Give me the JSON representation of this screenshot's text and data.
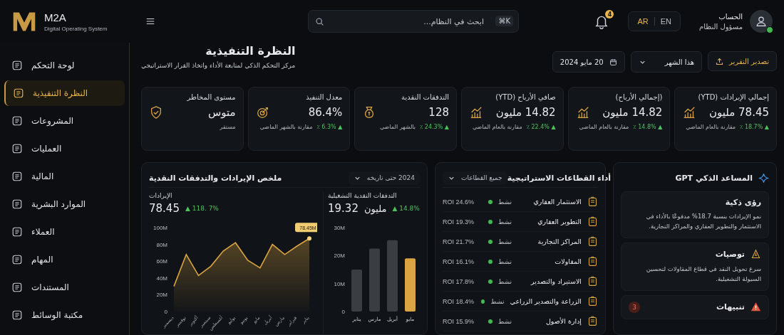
{
  "topbar": {
    "logo_text": "M2A",
    "logo_subtitle": "Digital Operating System",
    "search": {
      "placeholder": "ابحث في النظام...",
      "shortcut": "⌘K"
    },
    "notifications_count": "4",
    "languages": [
      {
        "label": "EN",
        "selected": false
      },
      {
        "label": "AR",
        "selected": true
      }
    ],
    "user": {
      "name": "الحساب",
      "role": "مسؤول النظام",
      "online": true
    }
  },
  "sidebar": {
    "items": [
      {
        "label": "لوحة التحكم",
        "selected": false
      },
      {
        "label": "النظرة التنفيذية",
        "selected": true
      },
      {
        "label": "المشروعات",
        "selected": false
      },
      {
        "label": "العمليات",
        "selected": false
      },
      {
        "label": "المالية",
        "selected": false
      },
      {
        "label": "الموارد البشرية",
        "selected": false
      },
      {
        "label": "العملاء",
        "selected": false
      },
      {
        "label": "المهام",
        "selected": false
      },
      {
        "label": "المستندات",
        "selected": false
      },
      {
        "label": "مكتبة الوسائط",
        "selected": false
      }
    ]
  },
  "header": {
    "title": "النظرة التنفيذية",
    "subtitle": "مركز التحكم الذكي لمتابعة الأداء واتخاذ القرار الاستراتيجي",
    "date": "20 مايو 2024",
    "period": "هذا الشهر",
    "export_button": "تصدير التقرير"
  },
  "kpis": [
    {
      "title": "إجمالي الإيرادات (YTD)",
      "value": "78.45 مليون",
      "change": "▲ 18.7% ٪",
      "note": "مقارنة بالعام الماضي"
    },
    {
      "title": "(إجمالي الأرباح)",
      "value": "14.82 مليون",
      "change": "▲ 14.8% ٪",
      "note": "مقارنة بالعام الماضي"
    },
    {
      "title": "صافي الأرباح (YTD)",
      "value": "14.82 مليون",
      "change": "▲ 22.4% ٪",
      "note": "مقارنة بالعام الماضي"
    },
    {
      "title": "التدفقات النقدية",
      "value": "128",
      "change": "▲ 24.3% ٪",
      "note": "بالشهر الماضي"
    },
    {
      "title": "معدل التنفيذ",
      "value": "86.4%",
      "change": "▲ 6.3% ٪",
      "note": "مقارنة بالشهر الماضي"
    },
    {
      "title": "مستوى المخاطر",
      "value": "متوس",
      "note": "مستقر"
    }
  ],
  "revenue_panel": {
    "title": "ملخص الإيرادات والتدفقات النقدية",
    "filter": "2024 حتى تاريخه",
    "revenue": {
      "label": "الإيرادات",
      "value": "78.45",
      "change": "▲ 118. 7%",
      "chart_data": {
        "type": "area",
        "categories": [
          "ديسمبر",
          "نوفمبر",
          "أكتوبر",
          "سبتمبر",
          "أغسطس",
          "يوليو",
          "يونيو",
          "مايو",
          "أبريل",
          "مارس",
          "فبراير",
          "يناير"
        ],
        "series": [
          {
            "color": "#d9a441",
            "values": [
              30,
              68,
              43,
              54,
              72,
              82,
              61,
              52,
              80,
              68,
              78,
              87
            ]
          }
        ],
        "ylim": [
          0,
          100
        ],
        "yticks": [
          {
            "value": 0,
            "label": "0"
          },
          {
            "value": 20,
            "label": "20M"
          },
          {
            "value": 40,
            "label": "40M"
          },
          {
            "value": 60,
            "label": "60M"
          },
          {
            "value": 80,
            "label": "80M"
          },
          {
            "value": 100,
            "label": "100M"
          }
        ],
        "annotations": [
          {
            "text": "78.45M",
            "x": "يناير",
            "y": 87
          }
        ]
      }
    },
    "cash_flow": {
      "label": "التدفقات النقدية التشغيلية",
      "value": "19.32",
      "unit": "مليون",
      "change": "▲ 14.8%",
      "chart_data": {
        "type": "bar",
        "categories": [
          "يناير",
          "مارس",
          "أبريل",
          "مايو"
        ],
        "series": [
          {
            "color": "#3a3d42",
            "values": [
              15,
              22.5,
              25.5,
              null
            ]
          },
          {
            "color": "#d9a441",
            "values": [
              null,
              null,
              null,
              19
            ]
          }
        ],
        "ylim": [
          0,
          30
        ],
        "yticks": [
          {
            "value": 0,
            "label": "0"
          },
          {
            "value": 10,
            "label": "10M"
          },
          {
            "value": 20,
            "label": "20M"
          },
          {
            "value": 30,
            "label": "30M"
          }
        ]
      }
    }
  },
  "segments_panel": {
    "title": "أداء القطاعات الاستراتيجية",
    "filter": "جميع القطاعات",
    "rows": [
      {
        "name": "الاستثمار العقاري",
        "status": "نشط",
        "color": "#3fb950",
        "roi": "ROI 24.6%"
      },
      {
        "name": "التطوير العقاري",
        "status": "نشط",
        "color": "#3fb950",
        "roi": "ROI 19.3%"
      },
      {
        "name": "المراكز التجارية",
        "status": "نشط",
        "color": "#3fb950",
        "roi": "ROI 21.7%"
      },
      {
        "name": "المقاولات",
        "status": "نشط",
        "color": "#3fb950",
        "roi": "ROI 16.1%"
      },
      {
        "name": "الاستيراد والتصدير",
        "status": "نشط",
        "color": "#3fb950",
        "roi": "ROI 17.8%"
      },
      {
        "name": "الزراعة والتصدير الزراعي",
        "status": "نشط",
        "color": "#3fb950",
        "roi": "ROI 18.4%"
      },
      {
        "name": "إدارة الأصول",
        "status": "نشط",
        "color": "#3fb950",
        "roi": "ROI 15.9%"
      }
    ]
  },
  "assistant_panel": {
    "title": "المساعد الذكي GPT",
    "cards": [
      {
        "kind": "insight",
        "title": "رؤى ذكية",
        "text": "نمو الإيرادات بنسبة 18.7% مدفوعًا بالأداء في الاستثمار والتطوير العقاري والمراكز التجارية."
      },
      {
        "kind": "recommendation",
        "title": "توصيات",
        "text": "سرع تحويل النقد في قطاع المقاولات لتحسين السيولة التشغيلية."
      },
      {
        "kind": "alert",
        "title": "تنبيهات",
        "count": "3"
      }
    ]
  }
}
